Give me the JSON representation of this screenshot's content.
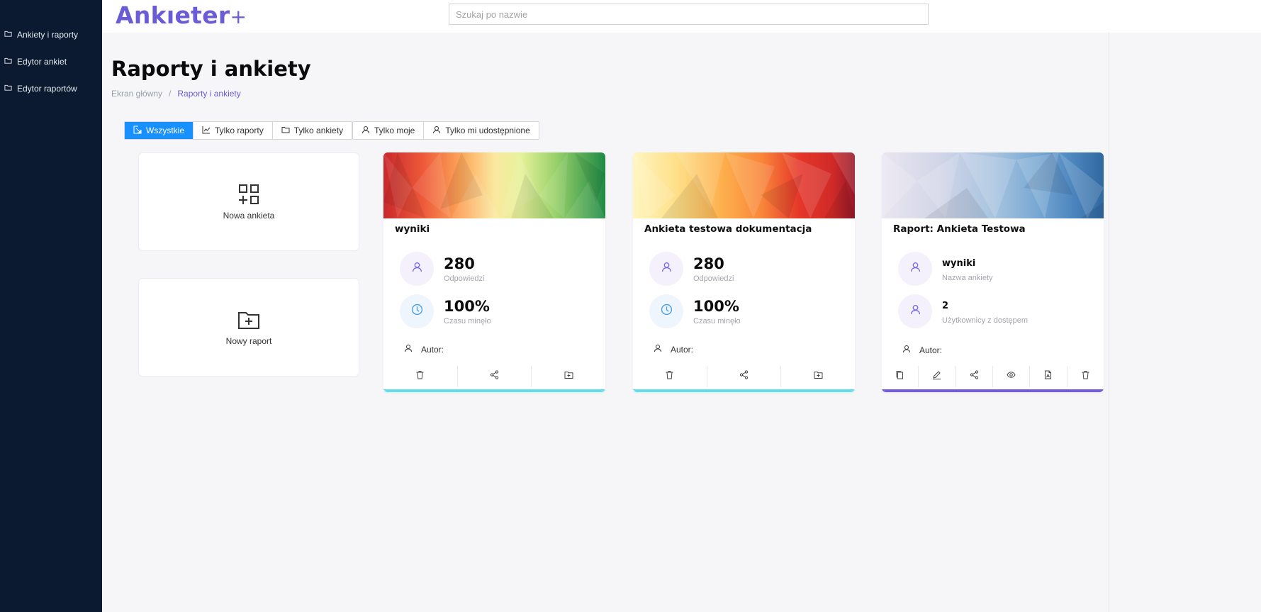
{
  "app": {
    "logo_text": "Ankıeter",
    "logo_plus": "+"
  },
  "sidebar": {
    "items": [
      {
        "label": "Ankiety i raporty",
        "icon": "folder-icon"
      },
      {
        "label": "Edytor ankiet",
        "icon": "folder-icon"
      },
      {
        "label": "Edytor raportów",
        "icon": "folder-icon"
      }
    ]
  },
  "search": {
    "placeholder": "Szukaj po nazwie",
    "value": ""
  },
  "page": {
    "title": "Raporty i ankiety",
    "breadcrumb": [
      "Ekran główny",
      "Raporty i ankiety"
    ],
    "breadcrumb_sep": "/"
  },
  "filters": {
    "type_group": [
      {
        "label": "Wszystkie",
        "icon": "select-all-icon",
        "active": true
      },
      {
        "label": "Tylko raporty",
        "icon": "line-chart-icon",
        "active": false
      },
      {
        "label": "Tylko ankiety",
        "icon": "folder-icon",
        "active": false
      }
    ],
    "owner_group": [
      {
        "label": "Tylko moje",
        "icon": "user-icon",
        "active": false
      },
      {
        "label": "Tylko mi udostępnione",
        "icon": "user-icon",
        "active": false
      }
    ]
  },
  "create": {
    "new_survey": "Nowa ankieta",
    "new_report": "Nowy raport"
  },
  "cards": [
    {
      "title": "wyniki",
      "stats": [
        {
          "value": "280",
          "label": "Odpowiedzi",
          "icon": "user-icon"
        },
        {
          "value": "100%",
          "label": "Czasu minęło",
          "icon": "clock-icon"
        }
      ],
      "author_label": "Autor:",
      "actions": [
        "delete-icon",
        "share-icon",
        "folder-add-icon"
      ],
      "accent": "#5ee0e6"
    },
    {
      "title": "Ankieta testowa dokumentacja",
      "stats": [
        {
          "value": "280",
          "label": "Odpowiedzi",
          "icon": "user-icon"
        },
        {
          "value": "100%",
          "label": "Czasu minęło",
          "icon": "clock-icon"
        }
      ],
      "author_label": "Autor:",
      "actions": [
        "delete-icon",
        "share-icon",
        "folder-add-icon"
      ],
      "accent": "#5ee0e6"
    },
    {
      "title": "Raport: Ankieta Testowa",
      "stats": [
        {
          "value": "wyniki",
          "label": "Nazwa ankiety",
          "icon": "user-icon"
        },
        {
          "value": "2",
          "label": "Użytkownicy z dostępem",
          "icon": "user-icon"
        }
      ],
      "author_label": "Autor:",
      "actions": [
        "copy-icon",
        "edit-icon",
        "share-icon",
        "eye-icon",
        "pdf-icon",
        "delete-icon"
      ],
      "accent": "#6f5ce0"
    }
  ],
  "colors": {
    "sidebar_bg": "#0b1a30",
    "brand": "#6a5cd6",
    "primary_button": "#1890ff",
    "survey_accent": "#5ee0e6",
    "report_accent": "#6f5ce0"
  }
}
